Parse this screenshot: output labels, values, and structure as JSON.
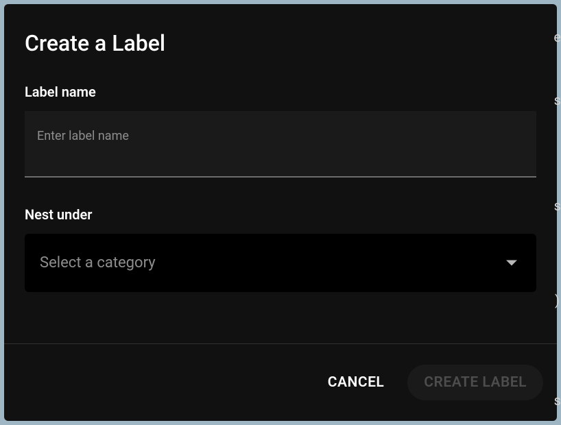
{
  "modal": {
    "title": "Create a Label",
    "labelName": {
      "label": "Label name",
      "placeholder": "Enter label name",
      "value": ""
    },
    "nestUnder": {
      "label": "Nest under",
      "placeholder": "Select a category"
    },
    "footer": {
      "cancel": "CANCEL",
      "create": "CREATE LABEL"
    }
  },
  "bgHints": {
    "e": "e",
    "s1": "s",
    "s2": "s",
    "paren": ")",
    "s3": "s"
  }
}
